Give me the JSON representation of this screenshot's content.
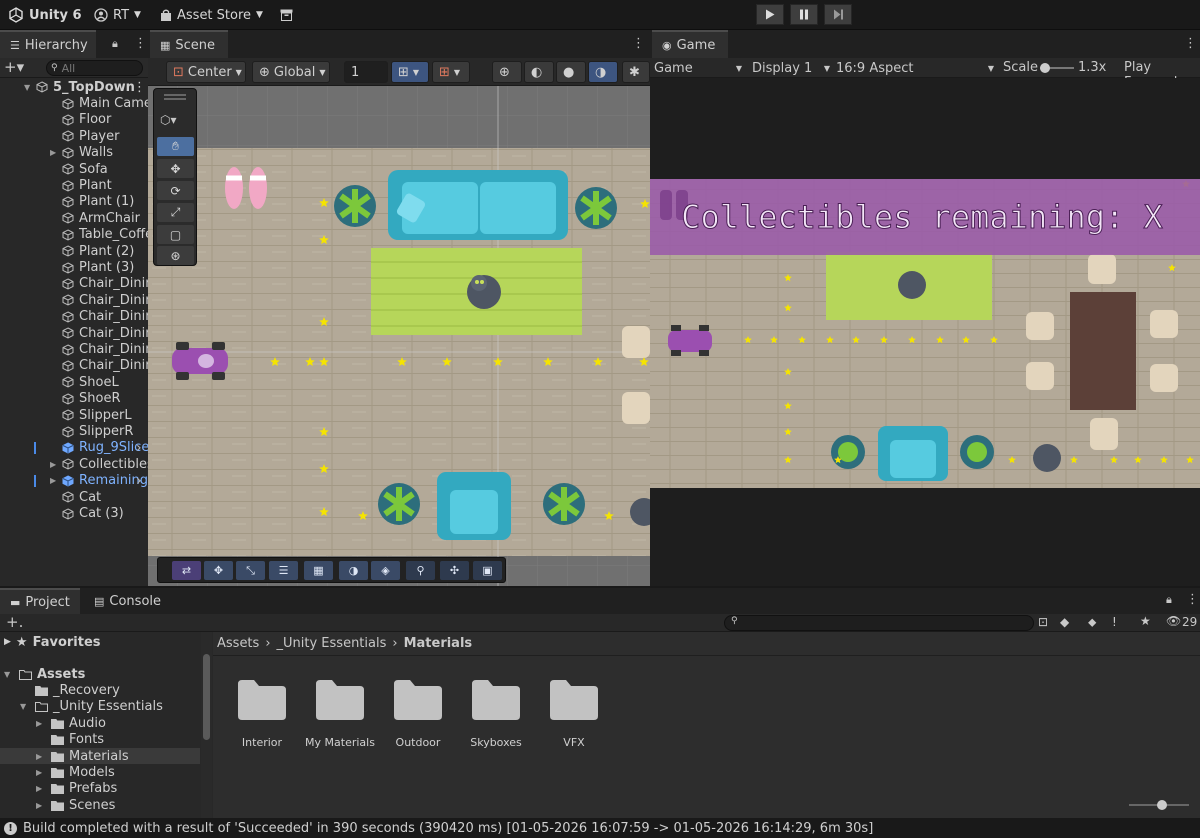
{
  "topbar": {
    "app": "Unity 6",
    "account": "RT",
    "store": "Asset Store"
  },
  "panels": {
    "hierarchy": "Hierarchy",
    "scene": "Scene",
    "game": "Game",
    "project": "Project",
    "console": "Console"
  },
  "hierarchy": {
    "search_placeholder": "All",
    "items": [
      {
        "label": "5_TopDown",
        "depth": 0,
        "expand": "open",
        "style": "root"
      },
      {
        "label": "Main Camera",
        "depth": 1
      },
      {
        "label": "Floor",
        "depth": 1
      },
      {
        "label": "Player",
        "depth": 1
      },
      {
        "label": "Walls",
        "depth": 1,
        "expand": "closed"
      },
      {
        "label": "Sofa",
        "depth": 1
      },
      {
        "label": "Plant",
        "depth": 1
      },
      {
        "label": "Plant (1)",
        "depth": 1
      },
      {
        "label": "ArmChair",
        "depth": 1
      },
      {
        "label": "Table_Coffee",
        "depth": 1
      },
      {
        "label": "Plant (2)",
        "depth": 1
      },
      {
        "label": "Plant (3)",
        "depth": 1
      },
      {
        "label": "Chair_Dining",
        "depth": 1
      },
      {
        "label": "Chair_Dining",
        "depth": 1
      },
      {
        "label": "Chair_Dining",
        "depth": 1
      },
      {
        "label": "Chair_Dining",
        "depth": 1
      },
      {
        "label": "Chair_Dining",
        "depth": 1
      },
      {
        "label": "Chair_Dining",
        "depth": 1
      },
      {
        "label": "ShoeL",
        "depth": 1
      },
      {
        "label": "ShoeR",
        "depth": 1
      },
      {
        "label": "SlipperL",
        "depth": 1
      },
      {
        "label": "SlipperR",
        "depth": 1
      },
      {
        "label": "Rug_9Slice",
        "depth": 1,
        "style": "prefab",
        "arrow": true
      },
      {
        "label": "Collectibles",
        "depth": 1,
        "expand": "closed"
      },
      {
        "label": "Remaining",
        "depth": 1,
        "style": "prefab",
        "expand": "closed",
        "arrow": true
      },
      {
        "label": "Cat",
        "depth": 1
      },
      {
        "label": "Cat (3)",
        "depth": 1
      }
    ]
  },
  "scene_toolbar": {
    "pivot": "Center",
    "space": "Global",
    "snap_value": "1"
  },
  "game_toolbar": {
    "view": "Game",
    "display": "Display 1",
    "aspect": "16:9 Aspect",
    "scale_label": "Scale",
    "scale_value": "1.3x",
    "play_mode": "Play Focused"
  },
  "game_view": {
    "banner_text": "Collectibles remaining: X"
  },
  "project": {
    "favorites": "Favorites",
    "tree": [
      {
        "label": "Assets",
        "depth": 0,
        "expand": "open",
        "bold": true
      },
      {
        "label": "_Recovery",
        "depth": 1
      },
      {
        "label": "_Unity Essentials",
        "depth": 1,
        "expand": "open"
      },
      {
        "label": "Audio",
        "depth": 2,
        "expand": "closed"
      },
      {
        "label": "Fonts",
        "depth": 2
      },
      {
        "label": "Materials",
        "depth": 2,
        "expand": "closed",
        "selected": true
      },
      {
        "label": "Models",
        "depth": 2,
        "expand": "closed"
      },
      {
        "label": "Prefabs",
        "depth": 2,
        "expand": "closed"
      },
      {
        "label": "Scenes",
        "depth": 2,
        "expand": "closed"
      }
    ],
    "breadcrumb": [
      "Assets",
      "_Unity Essentials",
      "Materials"
    ],
    "folders": [
      "Interior",
      "My Materials",
      "Outdoor",
      "Skyboxes",
      "VFX"
    ],
    "visible_count": "29"
  },
  "status": {
    "message": "Build completed with a result of 'Succeeded' in 390 seconds (390420 ms) [01-05-2026 16:07:59 -> 01-05-2026 16:14:29, 6m 30s]"
  },
  "colors": {
    "accent": "#4c6fa0",
    "prefab": "#7fb3ff",
    "banner": "#9a5aa8",
    "floor": "#b8ad9b",
    "sofa": "#3fbcd2",
    "rug": "#b6d65a",
    "star": "#f5e400"
  }
}
